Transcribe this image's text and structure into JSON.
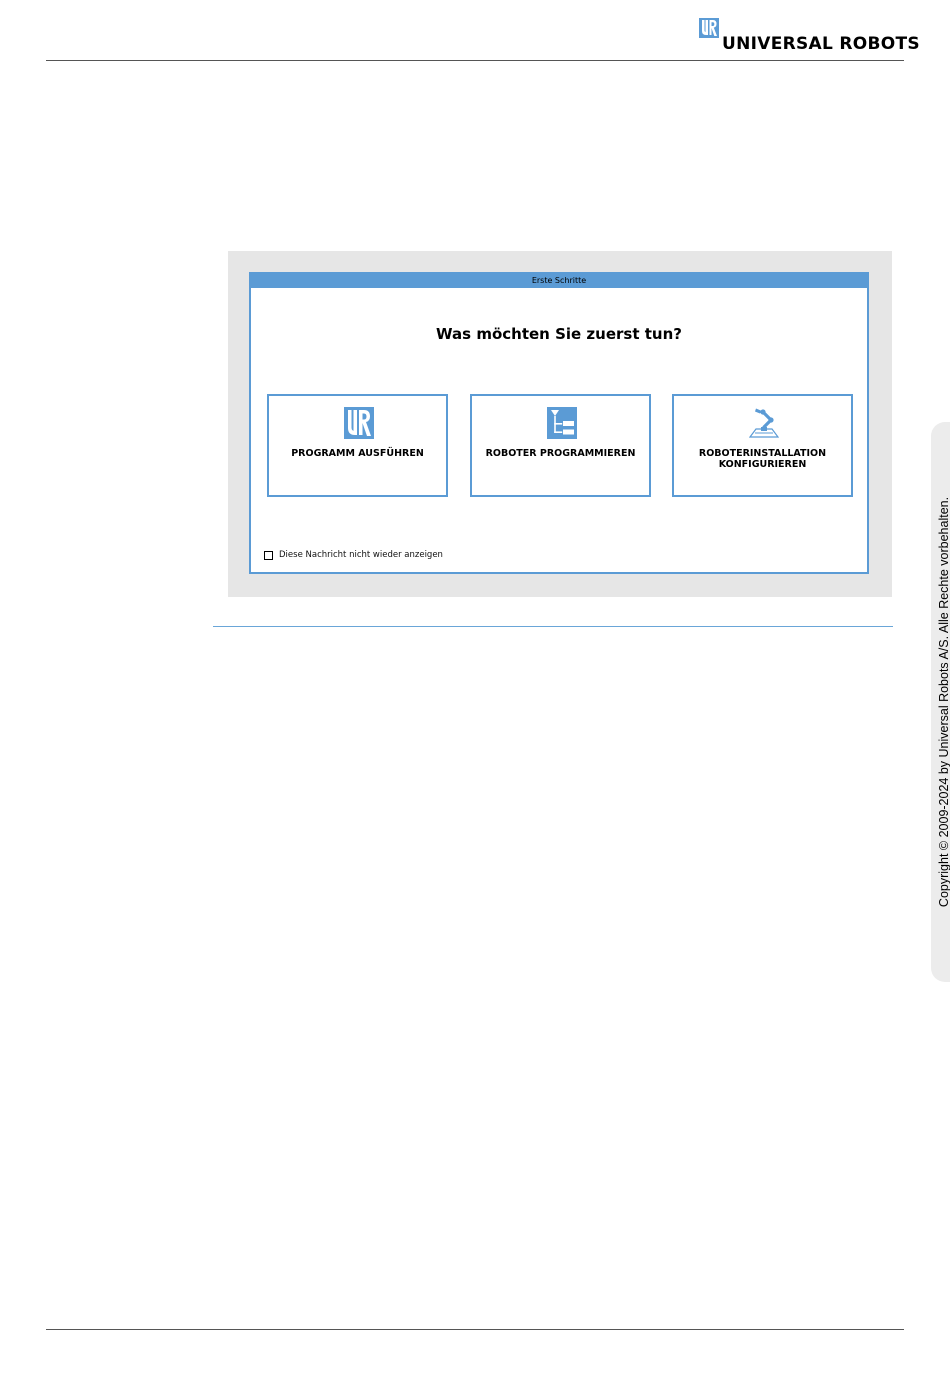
{
  "header": {
    "brand": "UNIVERSAL ROBOTS",
    "logo_icon": "ur-logo-icon",
    "accent_color": "#5b9bd5"
  },
  "dialog": {
    "title": "Erste Schritte",
    "question": "Was möchten Sie zuerst tun?",
    "options": [
      {
        "label": "PROGRAMM AUSFÜHREN",
        "icon": "ur-logo-icon"
      },
      {
        "label": "ROBOTER PROGRAMMIEREN",
        "icon": "program-tree-icon"
      },
      {
        "label": "ROBOTERINSTALLATION\nKONFIGURIEREN",
        "icon": "robot-arm-icon"
      }
    ],
    "dont_show_again": "Diese Nachricht nicht wieder anzeigen",
    "dont_show_checked": false
  },
  "side_tab": {
    "copyright": "Copyright © 2009-2024 by Universal Robots A/S. Alle Rechte vorbehalten."
  }
}
